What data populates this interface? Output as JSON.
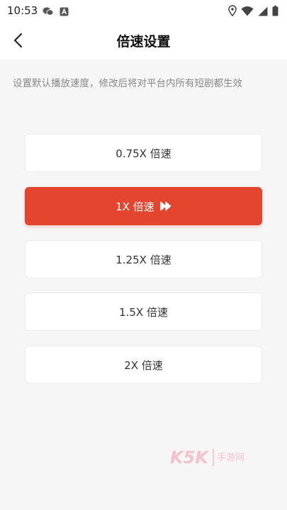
{
  "status_bar": {
    "time": "10:53",
    "icons_left": [
      "wechat-icon",
      "a-icon"
    ],
    "icons_right": [
      "location-icon",
      "wifi-icon",
      "signal-icon",
      "battery-icon"
    ]
  },
  "header": {
    "title": "倍速设置"
  },
  "description": "设置默认播放速度，修改后将对平台内所有短剧都生效",
  "options": [
    {
      "label": "0.75X 倍速",
      "selected": false
    },
    {
      "label": "1X 倍速",
      "selected": true
    },
    {
      "label": "1.25X 倍速",
      "selected": false
    },
    {
      "label": "1.5X 倍速",
      "selected": false
    },
    {
      "label": "2X 倍速",
      "selected": false
    }
  ],
  "colors": {
    "accent": "#e4452f",
    "background": "#f6f6f6"
  },
  "watermark": {
    "brand": "K5K",
    "text": "手游网"
  }
}
